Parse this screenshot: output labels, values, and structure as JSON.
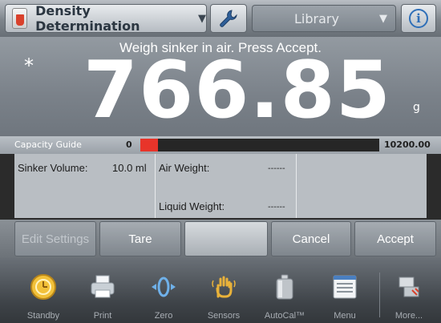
{
  "header": {
    "app_name": "Density Determination",
    "library_label": "Library",
    "icons": [
      "density-app-icon",
      "wrench-icon",
      "chevron-down-icon",
      "info-icon"
    ]
  },
  "display": {
    "prompt": "Weigh sinker in air. Press Accept.",
    "stable_marker": "*",
    "weight": "766.85",
    "unit": "g"
  },
  "capacity": {
    "label": "Capacity Guide",
    "min": "0",
    "max": "10200.00",
    "fill_fraction": 0.075,
    "fill_color": "#e8342a"
  },
  "info": {
    "sinker_volume_label": "Sinker Volume:",
    "sinker_volume_value": "10.0 ml",
    "air_weight_label": "Air Weight:",
    "air_weight_value": "------",
    "liquid_weight_label": "Liquid Weight:",
    "liquid_weight_value": "------"
  },
  "actions": {
    "edit_settings": "Edit Settings",
    "tare": "Tare",
    "cancel": "Cancel",
    "accept": "Accept"
  },
  "iconbar": {
    "standby": "Standby",
    "print": "Print",
    "zero": "Zero",
    "sensors": "Sensors",
    "autocal": "AutoCal™",
    "menu": "Menu",
    "more": "More..."
  }
}
